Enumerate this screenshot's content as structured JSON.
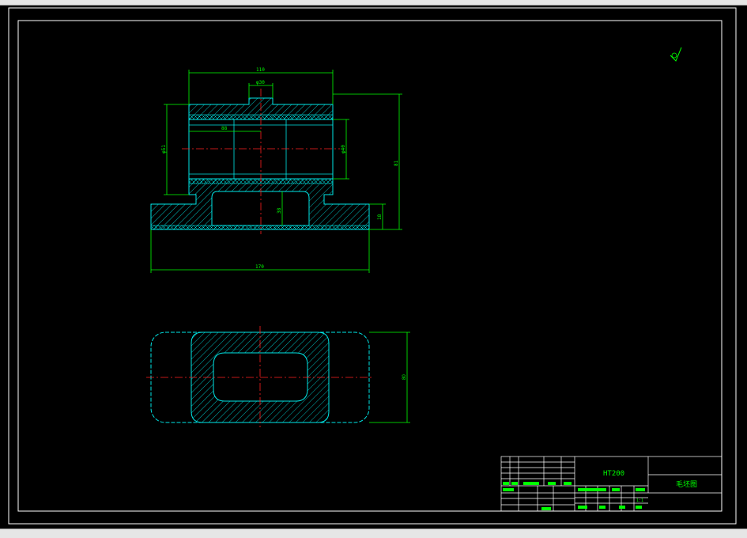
{
  "drawing": {
    "colors": {
      "background": "#000000",
      "outline": "#00e6e6",
      "dimension": "#00ff00",
      "centerline": "#ff2020",
      "hatch": "#00e6e6",
      "border": "#ffffff",
      "label_fill": "#00ff00"
    },
    "front_view": {
      "dimensions": {
        "top_width": "110",
        "boss_width": "φ30",
        "bore_depth": "88",
        "inner_dia": "φ40",
        "left_dia": "φ51",
        "total_height": "81",
        "pocket_height": "38",
        "base_height": "18",
        "base_width": "170"
      }
    },
    "plan_view": {
      "dimensions": {
        "height": "80"
      }
    },
    "surface_finish_symbol": "√",
    "title_block": {
      "material": "HT200",
      "drawing_title": "毛坯图",
      "scale_label": "比例",
      "scale_value": "1:1"
    }
  }
}
